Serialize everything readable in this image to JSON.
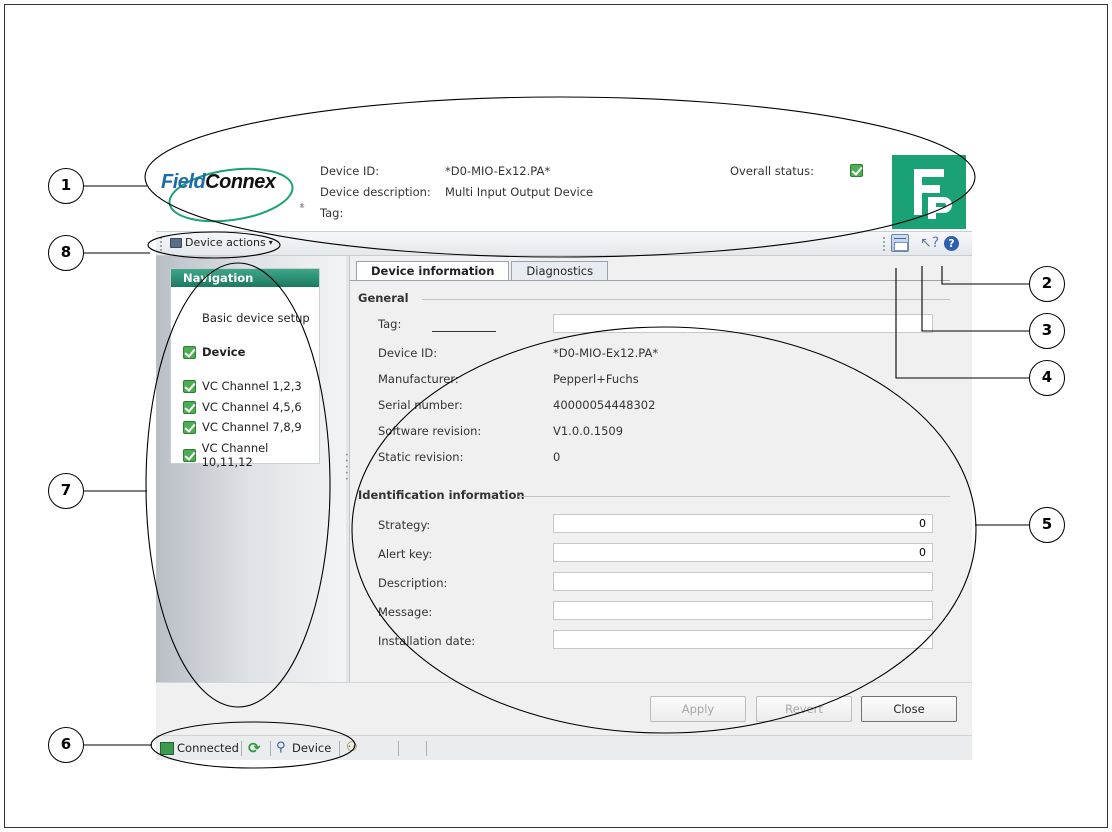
{
  "header": {
    "logo_text_field": "Field",
    "logo_text_connex": "Connex",
    "logo_registered": "®",
    "device_id_label": "Device ID:",
    "device_id_value": "*D0-MIO-Ex12.PA*",
    "device_description_label": "Device description:",
    "device_description_value": "Multi Input Output Device",
    "tag_label": "Tag:",
    "overall_status_label": "Overall status:"
  },
  "toolbar": {
    "device_actions_label": "Device actions",
    "caret": "▾",
    "pointer_help_glyph": "↖?",
    "help_glyph": "?"
  },
  "navigation": {
    "title": "Navigation",
    "items": [
      {
        "label": "Basic device setup",
        "checked": false,
        "bold": false
      },
      {
        "label": "Device",
        "checked": true,
        "bold": true
      },
      {
        "label": "VC Channel 1,2,3",
        "checked": true,
        "bold": false
      },
      {
        "label": "VC Channel 4,5,6",
        "checked": true,
        "bold": false
      },
      {
        "label": "VC Channel 7,8,9",
        "checked": true,
        "bold": false
      },
      {
        "label": "VC Channel 10,11,12",
        "checked": true,
        "bold": false
      }
    ]
  },
  "tabs": [
    {
      "label": "Device information",
      "active": true
    },
    {
      "label": "Diagnostics",
      "active": false
    }
  ],
  "general": {
    "title": "General",
    "tag_label": "Tag:",
    "tag_value": "",
    "fields": [
      {
        "label": "Device ID:",
        "value": "*D0-MIO-Ex12.PA*"
      },
      {
        "label": "Manufacturer:",
        "value": "Pepperl+Fuchs"
      },
      {
        "label": "Serial number:",
        "value": "40000054448302"
      },
      {
        "label": "Software revision:",
        "value": "V1.0.0.1509"
      },
      {
        "label": "Static revision:",
        "value": "0"
      }
    ]
  },
  "identification": {
    "title": "Identification information",
    "fields": [
      {
        "label": "Strategy:",
        "value": "0"
      },
      {
        "label": "Alert key:",
        "value": "0"
      },
      {
        "label": "Description:",
        "value": ""
      },
      {
        "label": "Message:",
        "value": ""
      },
      {
        "label": "Installation date:",
        "value": ""
      }
    ]
  },
  "footer": {
    "apply_label": "Apply",
    "revert_label": "Revert",
    "close_label": "Close"
  },
  "statusbar": {
    "connected_label": "Connected",
    "refresh_glyph": "⟳",
    "device_glyph": "⚲",
    "device_label": "Device",
    "users_glyph": "⚇"
  },
  "callouts": [
    "1",
    "2",
    "3",
    "4",
    "5",
    "6",
    "7",
    "8"
  ],
  "colors": {
    "accent_green": "#1aa276",
    "nav_title": "#1b7a60",
    "status_ok": "#4caf50",
    "help_blue": "#2f5fb0"
  }
}
